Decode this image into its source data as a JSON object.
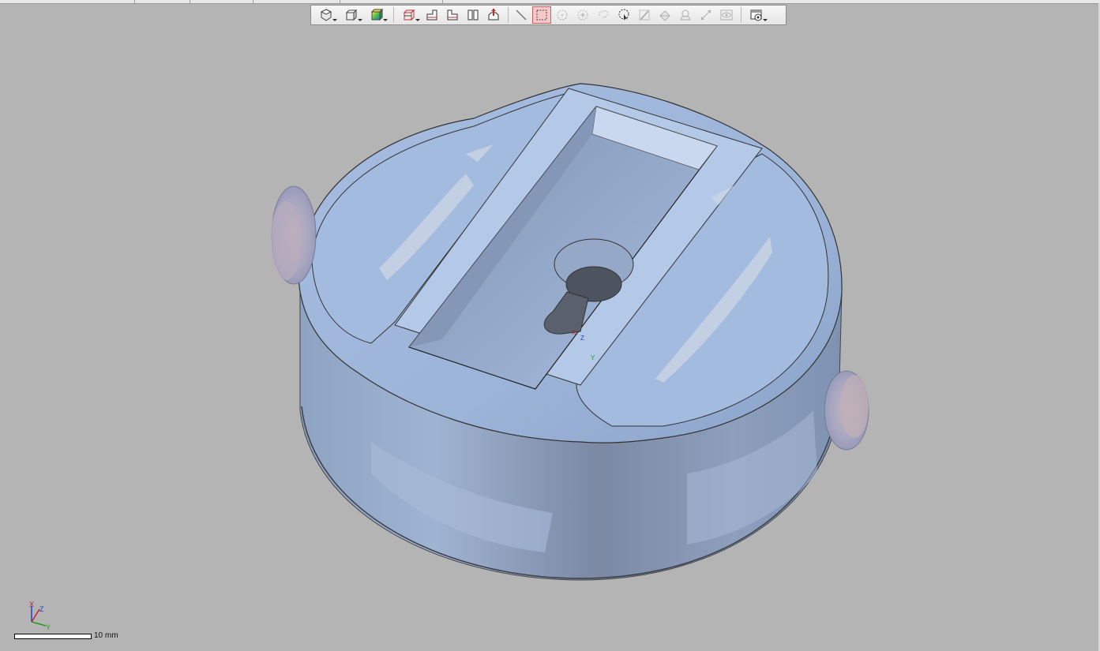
{
  "toolbar": {
    "buttons": [
      {
        "icon": "view-orientation-icon",
        "dropdown": true
      },
      {
        "icon": "cube-view-icon",
        "dropdown": true
      },
      {
        "icon": "shaded-display-icon",
        "dropdown": true
      },
      {
        "icon": "section-view-icon",
        "dropdown": true
      },
      {
        "icon": "front-view-icon"
      },
      {
        "icon": "side-view-icon"
      },
      {
        "icon": "split-view-icon"
      },
      {
        "icon": "zoom-fit-icon"
      },
      {
        "icon": "line-select-icon"
      },
      {
        "icon": "rectangle-select-icon",
        "active": true
      },
      {
        "icon": "circle-select-icon",
        "disabled": true
      },
      {
        "icon": "circle-point-select-icon",
        "disabled": true
      },
      {
        "icon": "lasso-select-icon",
        "disabled": true
      },
      {
        "icon": "paint-select-icon"
      },
      {
        "icon": "brush-select-icon",
        "disabled": true
      },
      {
        "icon": "surface-select-icon",
        "disabled": true
      },
      {
        "icon": "region-select-icon",
        "disabled": true
      },
      {
        "icon": "extend-select-icon",
        "disabled": true
      },
      {
        "icon": "visibility-icon",
        "disabled": true
      },
      {
        "icon": "display-settings-icon",
        "dropdown": true
      }
    ]
  },
  "viewport": {
    "background": "#b4b4b4",
    "model_color": "#9db4d6",
    "triad_labels": {
      "x": "X",
      "y": "Y",
      "z": "Z"
    },
    "scale_label": "10 mm"
  }
}
